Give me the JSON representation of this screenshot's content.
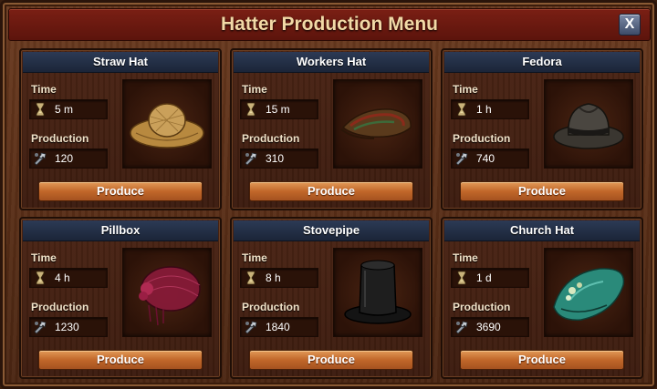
{
  "window": {
    "title": "Hatter Production Menu",
    "close_label": "X"
  },
  "labels": {
    "time": "Time",
    "production": "Production",
    "produce": "Produce"
  },
  "hats": [
    {
      "name": "Straw Hat",
      "time": "5 m",
      "production": "120",
      "icon": "straw-hat-icon"
    },
    {
      "name": "Workers Hat",
      "time": "15 m",
      "production": "310",
      "icon": "workers-hat-icon"
    },
    {
      "name": "Fedora",
      "time": "1 h",
      "production": "740",
      "icon": "fedora-icon"
    },
    {
      "name": "Pillbox",
      "time": "4 h",
      "production": "1230",
      "icon": "pillbox-hat-icon"
    },
    {
      "name": "Stovepipe",
      "time": "8 h",
      "production": "1840",
      "icon": "stovepipe-hat-icon"
    },
    {
      "name": "Church Hat",
      "time": "1 d",
      "production": "3690",
      "icon": "church-hat-icon"
    }
  ],
  "colors": {
    "title_text": "#f2d9a6",
    "header_blue": "#2c3a55",
    "button_orange": "#c1672a",
    "titlebar_red": "#7a1f14"
  }
}
